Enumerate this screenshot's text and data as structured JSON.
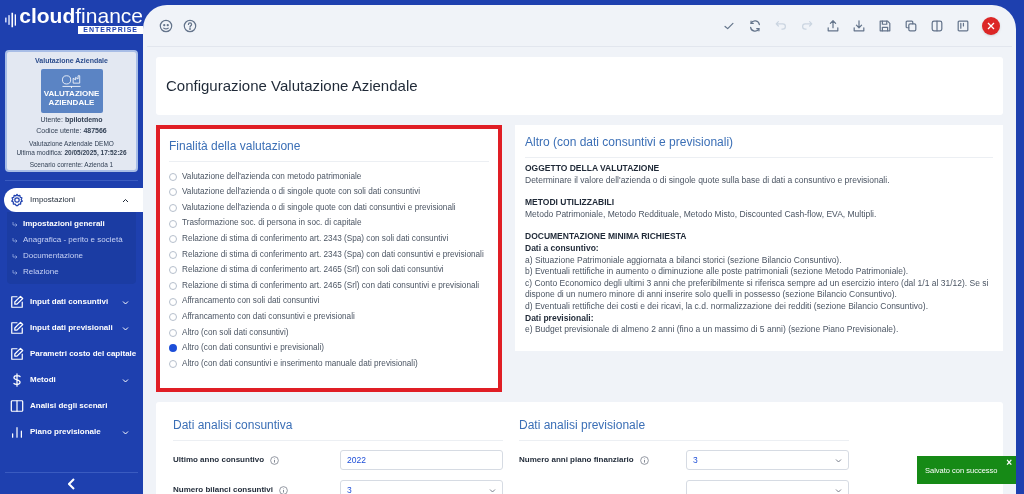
{
  "logo": {
    "bold": "cloud",
    "light": "finance",
    "badge": "ENTERPRISE"
  },
  "profile": {
    "title": "Valutazione Aziendale",
    "tile_caption": "VALUTAZIONE AZIENDALE",
    "user_label": "Utente:",
    "user": "bpilotdemo",
    "code_label": "Codice utente:",
    "code": "487566",
    "project": "Valutazione Aziendale DEMO",
    "modified_label": "Ultima modifica:",
    "modified": "20/05/2025, 17:52:26",
    "scenario": "Scenario corrente: Azienda 1"
  },
  "sidebar": {
    "items": [
      {
        "label": "Impostazioni",
        "kind": "gear",
        "selected": true,
        "expanded": true,
        "children": [
          {
            "label": "Impostazioni generali",
            "selected": true
          },
          {
            "label": "Anagrafica - perito e società",
            "selected": false
          },
          {
            "label": "Documentazione",
            "selected": false
          },
          {
            "label": "Relazione",
            "selected": false
          }
        ]
      },
      {
        "label": "Input dati consuntivi",
        "kind": "edit",
        "selected": false,
        "expanded": false
      },
      {
        "label": "Input dati previsionali",
        "kind": "edit",
        "selected": false,
        "expanded": false
      },
      {
        "label": "Parametri costo del capitale",
        "kind": "edit",
        "selected": false
      },
      {
        "label": "Metodi",
        "kind": "dollar",
        "selected": false,
        "expanded": false
      },
      {
        "label": "Analisi degli scenari",
        "kind": "book",
        "selected": false
      },
      {
        "label": "Piano previsionale",
        "kind": "bars",
        "selected": false,
        "expanded": false
      }
    ]
  },
  "toolbar": {
    "left": [
      {
        "kind": "face"
      },
      {
        "kind": "help"
      }
    ],
    "right": [
      {
        "kind": "check",
        "disabled": false
      },
      {
        "kind": "refresh",
        "disabled": false
      },
      {
        "kind": "undo",
        "disabled": true
      },
      {
        "kind": "redo",
        "disabled": true
      },
      {
        "kind": "upload",
        "disabled": false
      },
      {
        "kind": "download",
        "disabled": false
      },
      {
        "kind": "save",
        "disabled": false
      },
      {
        "kind": "copy",
        "disabled": false
      },
      {
        "kind": "columns",
        "disabled": false
      },
      {
        "kind": "board",
        "disabled": false
      },
      {
        "kind": "close"
      }
    ]
  },
  "page_title": "Configurazione Valutazione Aziendale",
  "purpose": {
    "title": "Finalità della valutazione",
    "highlighted": true,
    "options": [
      {
        "label": "Valutazione dell'azienda con metodo patrimoniale",
        "selected": false
      },
      {
        "label": "Valutazione dell'azienda o di singole quote con soli dati consuntivi",
        "selected": false
      },
      {
        "label": "Valutazione dell'azienda o di singole quote con dati consuntivi e previsionali",
        "selected": false
      },
      {
        "label": "Trasformazione soc. di persona in soc. di capitale",
        "selected": false
      },
      {
        "label": "Relazione di stima di conferimento art. 2343 (Spa) con soli dati consuntivi",
        "selected": false
      },
      {
        "label": "Relazione di stima di conferimento art. 2343 (Spa) con dati consuntivi e previsionali",
        "selected": false
      },
      {
        "label": "Relazione di stima di conferimento art. 2465 (Srl) con soli dati consuntivi",
        "selected": false
      },
      {
        "label": "Relazione di stima di conferimento art. 2465 (Srl) con dati consuntivi e previsionali",
        "selected": false
      },
      {
        "label": "Affrancamento con soli dati consuntivi",
        "selected": false
      },
      {
        "label": "Affrancamento con dati consuntivi e previsionali",
        "selected": false
      },
      {
        "label": "Altro (con soli dati consuntivi)",
        "selected": false
      },
      {
        "label": "Altro (con dati consuntivi e previsionali)",
        "selected": true
      },
      {
        "label": "Altro (con dati consuntivi e inserimento manuale dati previsionali)",
        "selected": false
      }
    ]
  },
  "description": {
    "title": "Altro (con dati consuntivi e previsionali)",
    "sections": [
      {
        "heading": "OGGETTO DELLA VALUTAZIONE",
        "lines": [
          {
            "kind": "text",
            "text": "Determinare il valore dell'azienda o di singole quote sulla base di dati a consuntivo e previsionali."
          }
        ]
      },
      {
        "heading": "METODI UTILIZZABILI",
        "lines": [
          {
            "kind": "text",
            "text": "Metodo Patrimoniale, Metodo Reddituale, Metodo Misto, Discounted Cash-flow, EVA, Multipli."
          }
        ]
      },
      {
        "heading": "DOCUMENTAZIONE MINIMA RICHIESTA",
        "lines": [
          {
            "kind": "subheading",
            "text": "Dati a consuntivo:"
          },
          {
            "kind": "text",
            "text": "a) Situazione Patrimoniale aggiornata a bilanci storici (sezione Bilancio Consuntivo)."
          },
          {
            "kind": "text",
            "text": "b) Eventuali rettifiche in aumento o diminuzione alle poste patrimoniali (sezione Metodo Patrimoniale)."
          },
          {
            "kind": "text",
            "text": "c) Conto Economico degli ultimi 3 anni che preferibilmente si riferisca sempre ad un esercizio intero (dal 1/1 al 31/12). Se si dispone di un numero minore di anni inserire solo quelli in possesso (sezione Bilancio Consuntivo)."
          },
          {
            "kind": "text",
            "text": "d) Eventuali rettifiche dei costi e dei ricavi, la c.d. normalizzazione dei redditi (sezione Bilancio Consuntivo)."
          },
          {
            "kind": "subheading",
            "text": "Dati previsionali:"
          },
          {
            "kind": "text",
            "text": "e) Budget previsionale di almeno 2 anni (fino a un massimo di 5 anni) (sezione Piano Previsionale)."
          }
        ]
      }
    ]
  },
  "analysis": [
    {
      "title": "Dati analisi consuntiva",
      "fields": [
        {
          "label": "Ultimo anno consuntivo",
          "kind": "input",
          "value": "2022"
        },
        {
          "label": "Numero bilanci consuntivi",
          "kind": "select",
          "value": "3"
        }
      ]
    },
    {
      "title": "Dati analisi previsionale",
      "fields": [
        {
          "label": "Numero anni piano finanziario",
          "kind": "select",
          "value": "3"
        },
        {
          "kind": "select"
        }
      ]
    }
  ],
  "toast": {
    "text": "Salvato con successo",
    "close": "×"
  }
}
